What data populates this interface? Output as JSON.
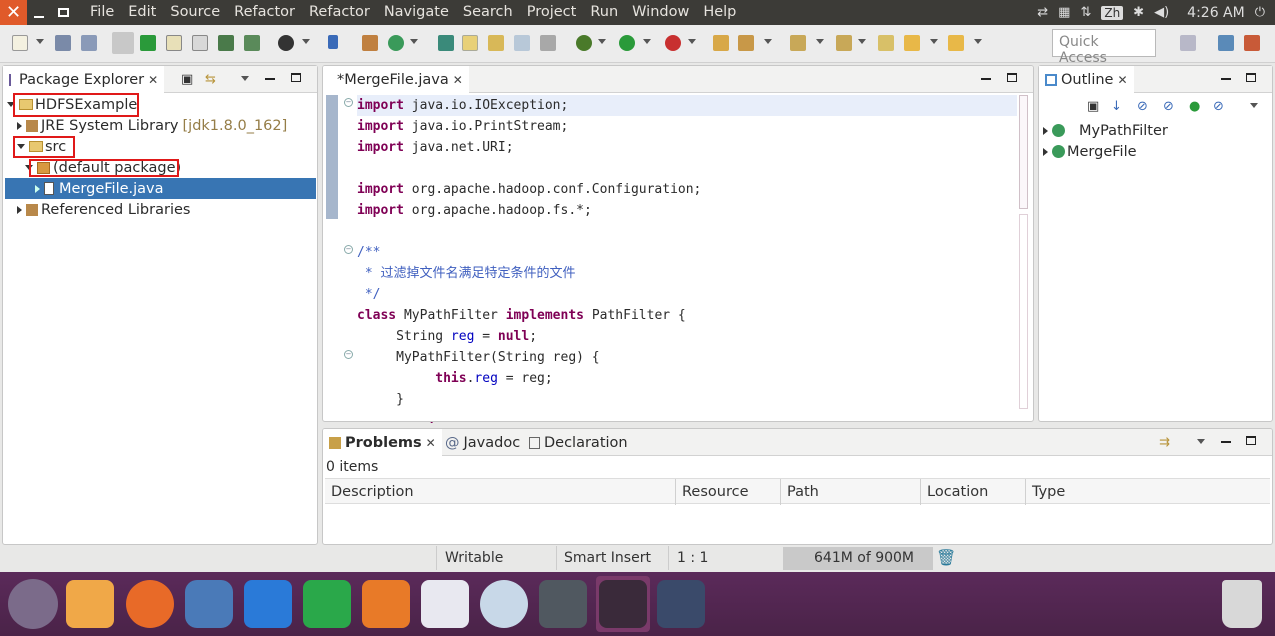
{
  "menubar": {
    "items": [
      "File",
      "Edit",
      "Source",
      "Refactor",
      "Refactor",
      "Navigate",
      "Search",
      "Project",
      "Run",
      "Window",
      "Help"
    ],
    "lang": "Zh",
    "time": "4:26 AM"
  },
  "toolbar": {
    "quick_access_placeholder": "Quick Access"
  },
  "package_explorer": {
    "title": "Package Explorer",
    "project": "HDFSExample",
    "jre_label": "JRE System Library",
    "jre_version": "[jdk1.8.0_162]",
    "src": "src",
    "package": "(default package)",
    "file": "MergeFile.java",
    "ref_libs": "Referenced Libraries"
  },
  "editor": {
    "tab": "*MergeFile.java",
    "lines": [
      [
        [
          "kw",
          "import"
        ],
        [
          "t",
          " java.io.IOException;"
        ]
      ],
      [
        [
          "kw",
          "import"
        ],
        [
          "t",
          " java.io.PrintStream;"
        ]
      ],
      [
        [
          "kw",
          "import"
        ],
        [
          "t",
          " java.net.URI;"
        ]
      ],
      [],
      [
        [
          "kw",
          "import"
        ],
        [
          "t",
          " org.apache.hadoop.conf.Configuration;"
        ]
      ],
      [
        [
          "kw",
          "import"
        ],
        [
          "t",
          " org.apache.hadoop.fs.*;"
        ]
      ],
      [],
      [
        [
          "cm",
          "/**"
        ]
      ],
      [
        [
          "cm",
          " * 过滤掉文件名满足特定条件的文件"
        ]
      ],
      [
        [
          "cm",
          " */"
        ]
      ],
      [
        [
          "kw",
          "class"
        ],
        [
          "t",
          " MyPathFilter "
        ],
        [
          "kw",
          "implements"
        ],
        [
          "t",
          " PathFilter {"
        ]
      ],
      [
        [
          "t",
          "     String "
        ],
        [
          "fld",
          "reg"
        ],
        [
          "t",
          " = "
        ],
        [
          "kw",
          "null"
        ],
        [
          "t",
          ";"
        ]
      ],
      [
        [
          "t",
          "     MyPathFilter(String reg) {"
        ]
      ],
      [
        [
          "t",
          "          "
        ],
        [
          "kw",
          "this"
        ],
        [
          "t",
          "."
        ],
        [
          "fld",
          "reg"
        ],
        [
          "t",
          " = reg;"
        ]
      ],
      [
        [
          "t",
          "     }"
        ]
      ],
      [
        [
          "t",
          "     "
        ],
        [
          "kw",
          "public"
        ],
        [
          "t",
          " "
        ],
        [
          "kw",
          "boolean"
        ],
        [
          "t",
          " accept(Path path) {"
        ]
      ]
    ]
  },
  "outline": {
    "title": "Outline",
    "items": [
      "MyPathFilter",
      "MergeFile"
    ]
  },
  "problems": {
    "tabs": [
      "Problems",
      "Javadoc",
      "Declaration"
    ],
    "count": "0 items",
    "columns": [
      "Description",
      "Resource",
      "Path",
      "Location",
      "Type"
    ]
  },
  "status": {
    "writable": "Writable",
    "insert": "Smart Insert",
    "position": "1 : 1",
    "memory": "641M of 900M"
  },
  "colors": {
    "keyword": "#7f0055",
    "comment": "#3f5fbf",
    "field": "#0000c0",
    "selection": "#3875b3",
    "dock": "#4a2348"
  }
}
